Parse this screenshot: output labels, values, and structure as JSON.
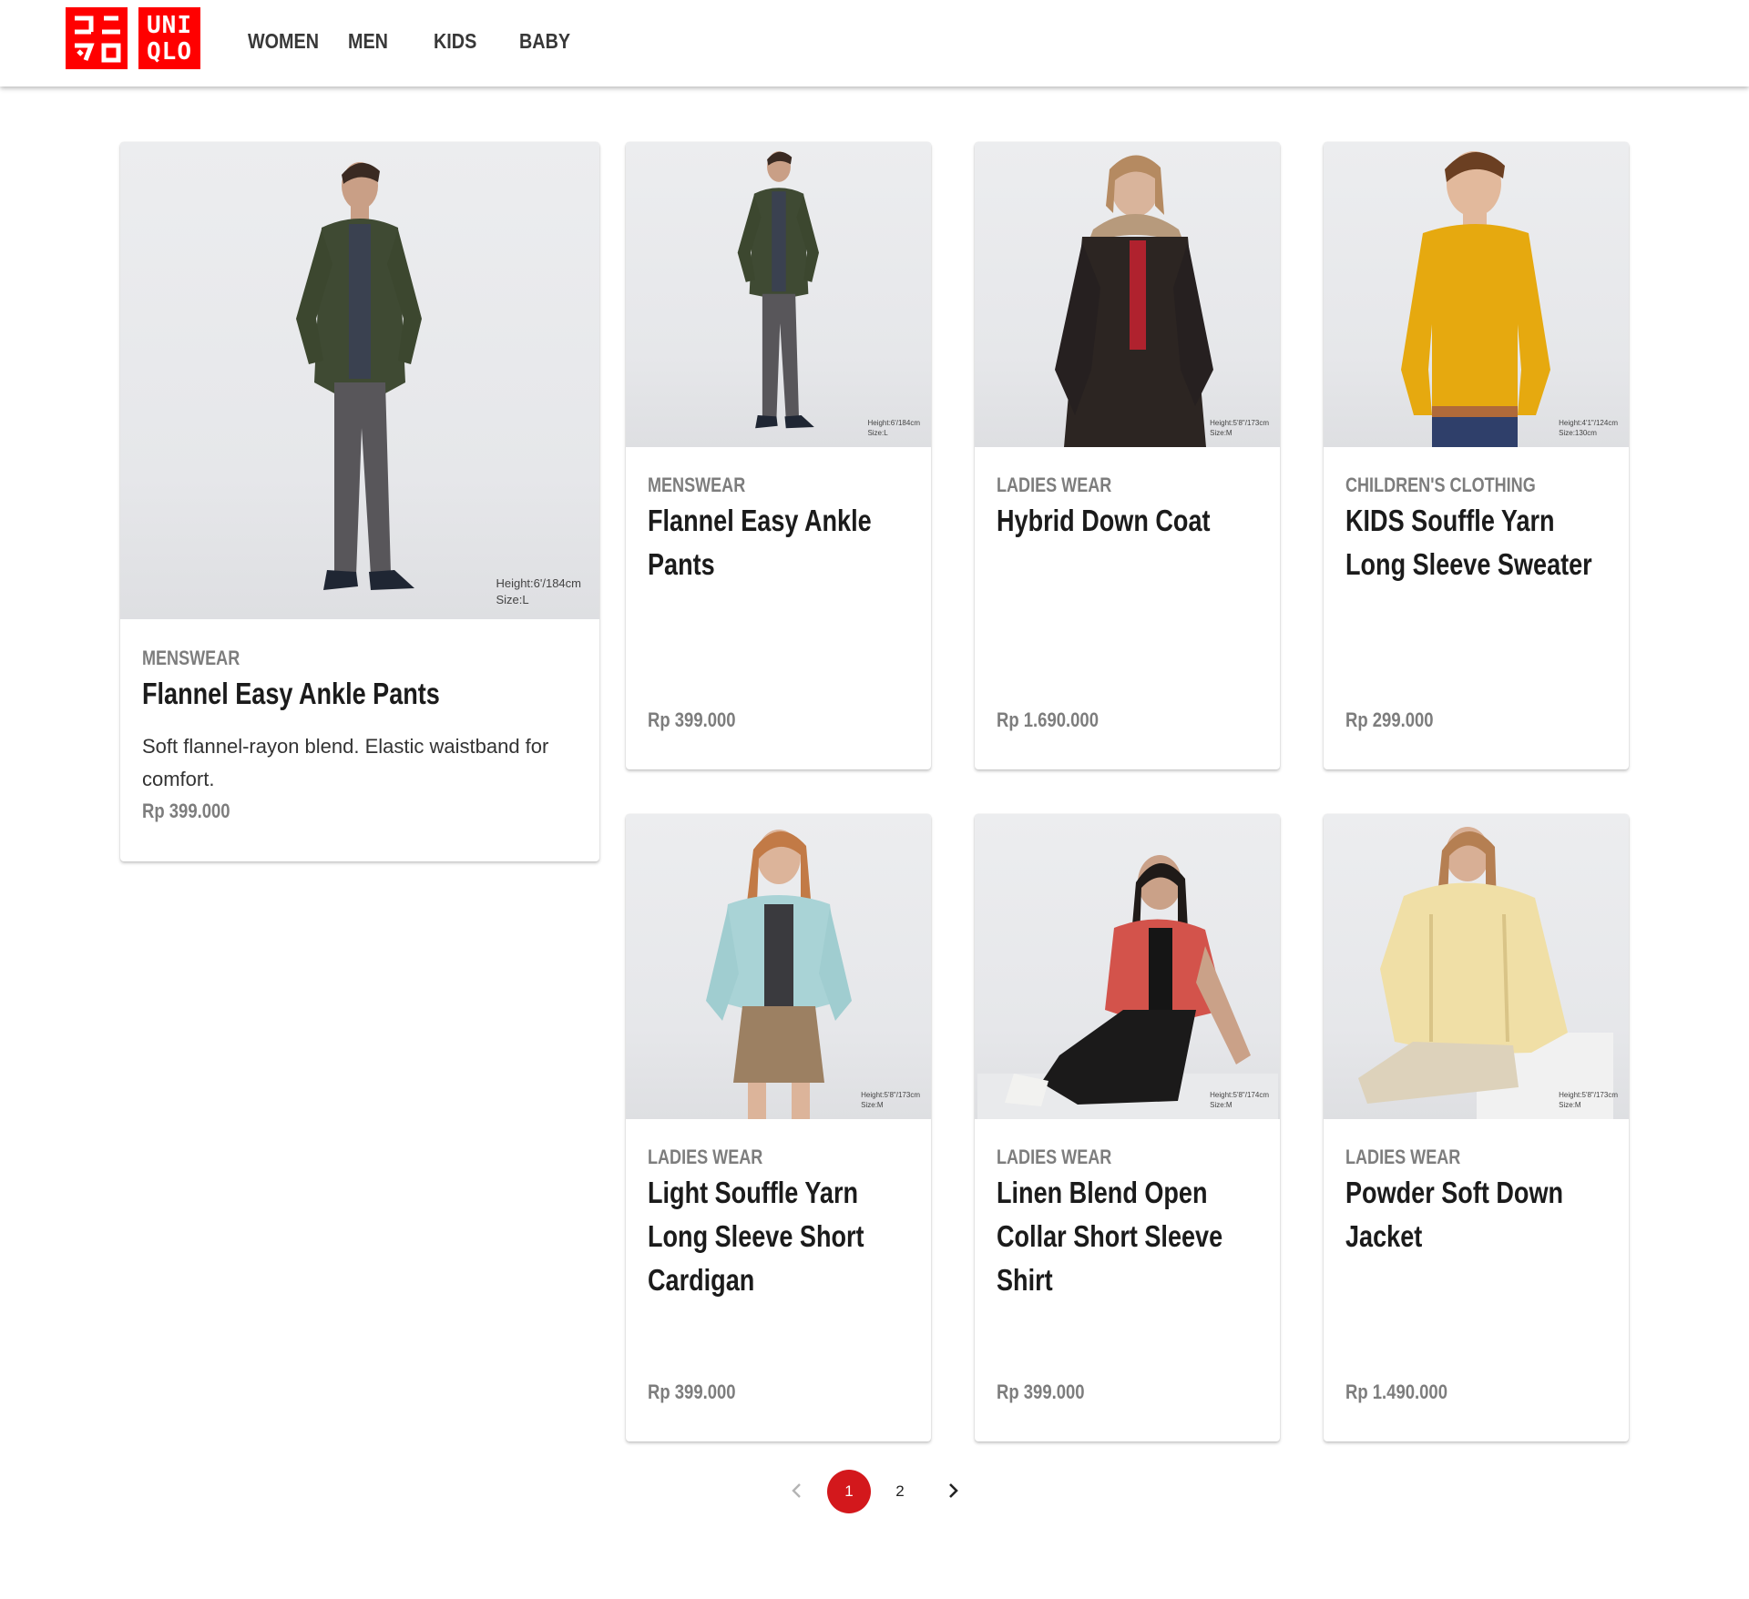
{
  "brand": {
    "logo_kana": "ユニクロ",
    "logo_top": "UNI",
    "logo_bottom": "QLO",
    "color": "#ff0000"
  },
  "nav": {
    "items": [
      {
        "label": "WOMEN"
      },
      {
        "label": "MEN"
      },
      {
        "label": "KIDS"
      },
      {
        "label": "BABY"
      }
    ]
  },
  "featured": {
    "category": "MENSWEAR",
    "title": "Flannel Easy Ankle Pants",
    "description": "Soft flannel-rayon blend. Elastic waistband for comfort.",
    "price": "Rp 399.000",
    "model_height": "Height:6'/184cm",
    "model_size": "Size:L"
  },
  "products": [
    {
      "category": "MENSWEAR",
      "title": "Flannel Easy Ankle Pants",
      "price": "Rp 399.000",
      "model_height": "Height:6'/184cm",
      "model_size": "Size:L",
      "image": "man-green-cardigan-grey-pants"
    },
    {
      "category": "LADIES WEAR",
      "title": "Hybrid Down Coat",
      "price": "Rp 1.690.000",
      "model_height": "Height:5'8\"/173cm",
      "model_size": "Size:M",
      "image": "woman-black-fur-hood-coat"
    },
    {
      "category": "CHILDREN'S CLOTHING",
      "title": "KIDS Souffle Yarn Long Sleeve Sweater",
      "price": "Rp 299.000",
      "model_height": "Height:4'1\"/124cm",
      "model_size": "Size:130cm",
      "image": "boy-yellow-sweater"
    },
    {
      "category": "LADIES WEAR",
      "title": "Light Souffle Yarn Long Sleeve Short Cardigan",
      "price": "Rp 399.000",
      "model_height": "Height:5'8\"/173cm",
      "model_size": "Size:M",
      "image": "woman-mint-cardigan"
    },
    {
      "category": "LADIES WEAR",
      "title": "Linen Blend Open Collar Short Sleeve Shirt",
      "price": "Rp 399.000",
      "model_height": "Height:5'8\"/174cm",
      "model_size": "Size:M",
      "image": "woman-red-shirt-black-dress"
    },
    {
      "category": "LADIES WEAR",
      "title": "Powder Soft Down Jacket",
      "price": "Rp 1.490.000",
      "model_height": "Height:5'8\"/173cm",
      "model_size": "Size:M",
      "image": "woman-cream-puffer-jacket"
    }
  ],
  "pagination": {
    "prev_icon": "chevron-left-icon",
    "next_icon": "chevron-right-icon",
    "pages": [
      "1",
      "2"
    ],
    "current": "1",
    "active_color": "#d3181c"
  }
}
